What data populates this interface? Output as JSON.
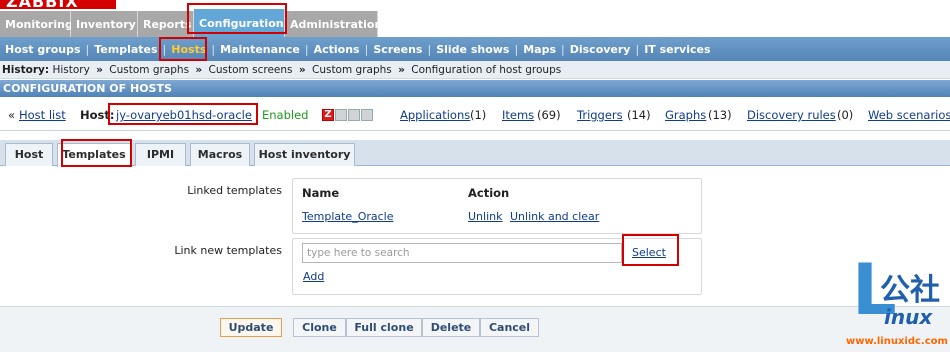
{
  "logo": {
    "text": "ZABBIX"
  },
  "main_menu": [
    {
      "label": "Monitoring"
    },
    {
      "label": "Inventory"
    },
    {
      "label": "Reports"
    },
    {
      "label": "Configuration"
    },
    {
      "label": "Administration"
    }
  ],
  "sub_menu": [
    {
      "label": "Host groups"
    },
    {
      "label": "Templates"
    },
    {
      "label": "Hosts"
    },
    {
      "label": "Maintenance"
    },
    {
      "label": "Actions"
    },
    {
      "label": "Screens"
    },
    {
      "label": "Slide shows"
    },
    {
      "label": "Maps"
    },
    {
      "label": "Discovery"
    },
    {
      "label": "IT services"
    }
  ],
  "history": {
    "label": "History:",
    "items": [
      "History",
      "Custom graphs",
      "Custom screens",
      "Custom graphs",
      "Configuration of host groups"
    ],
    "separator": "»"
  },
  "page_header": {
    "title": "CONFIGURATION OF HOSTS"
  },
  "host_line": {
    "prefix": "«",
    "host_list": "Host list",
    "host_label": "Host:",
    "host_name": "jy-ovaryeb01hsd-oracle",
    "status": "Enabled",
    "zabbix_icon_letter": "Z",
    "applications": "Applications",
    "applications_count": "(1)",
    "items": "Items",
    "items_count": "(69)",
    "triggers": "Triggers",
    "triggers_count": "(14)",
    "graphs": "Graphs",
    "graphs_count": "(13)",
    "discovery": "Discovery rules",
    "discovery_count": "(0)",
    "web": "Web scenarios"
  },
  "tabs": [
    {
      "label": "Host"
    },
    {
      "label": "Templates"
    },
    {
      "label": "IPMI"
    },
    {
      "label": "Macros"
    },
    {
      "label": "Host inventory"
    }
  ],
  "linked": {
    "label": "Linked templates",
    "col_name": "Name",
    "col_action": "Action",
    "template_name": "Template_Oracle",
    "unlink": "Unlink",
    "unlink_clear": "Unlink and clear"
  },
  "link_new": {
    "label": "Link new templates",
    "placeholder": "type here to search",
    "select": "Select",
    "add": "Add"
  },
  "buttons": {
    "update": "Update",
    "clone": "Clone",
    "full_clone": "Full clone",
    "delete": "Delete",
    "cancel": "Cancel"
  },
  "watermark": {
    "letter": "L",
    "chinese": "公社",
    "inux": "inux",
    "url": "www.linuxidc.com"
  },
  "colors": {
    "menu_active": "#62a7d7",
    "submenu": "#5585b6",
    "annotation": "#d20000",
    "enabled": "#1e9a1e"
  }
}
